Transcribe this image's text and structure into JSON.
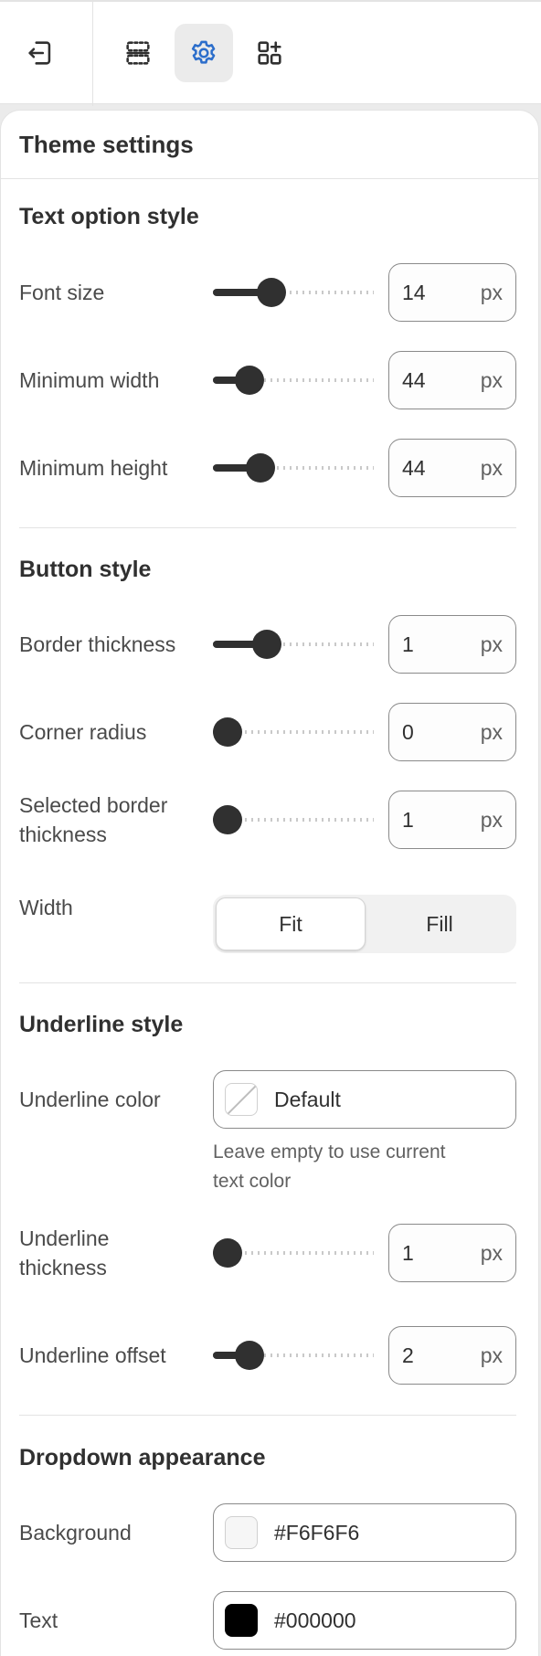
{
  "toolbar": {
    "buttons": [
      {
        "icon": "exit-icon"
      },
      {
        "icon": "sections-icon"
      },
      {
        "icon": "gear-icon",
        "active": true
      },
      {
        "icon": "apps-add-icon"
      }
    ]
  },
  "panel": {
    "title": "Theme settings"
  },
  "text_option_style": {
    "title": "Text option style",
    "font_size": {
      "label": "Font size",
      "value": "14",
      "unit": "px",
      "fraction": 0.33
    },
    "min_width": {
      "label": "Minimum width",
      "value": "44",
      "unit": "px",
      "fraction": 0.17
    },
    "min_height": {
      "label": "Minimum height",
      "value": "44",
      "unit": "px",
      "fraction": 0.25
    }
  },
  "button_style": {
    "title": "Button style",
    "border_thickness": {
      "label": "Border thickness",
      "value": "1",
      "unit": "px",
      "fraction": 0.3
    },
    "corner_radius": {
      "label": "Corner radius",
      "value": "0",
      "unit": "px",
      "fraction": 0.0
    },
    "selected_border": {
      "label_line1": "Selected border",
      "label_line2": "thickness",
      "value": "1",
      "unit": "px",
      "fraction": 0.0
    },
    "width": {
      "label": "Width",
      "options": [
        "Fit",
        "Fill"
      ],
      "selected": "Fit"
    }
  },
  "underline_style": {
    "title": "Underline style",
    "color": {
      "label": "Underline color",
      "value": "Default",
      "help_line1": "Leave empty to use current",
      "help_line2": "text color"
    },
    "thickness": {
      "label_line1": "Underline",
      "label_line2": "thickness",
      "value": "1",
      "unit": "px",
      "fraction": 0.0
    },
    "offset": {
      "label": "Underline offset",
      "value": "2",
      "unit": "px",
      "fraction": 0.17
    }
  },
  "dropdown_appearance": {
    "title": "Dropdown appearance",
    "background": {
      "label": "Background",
      "value": "#F6F6F6",
      "swatch": "#F6F6F6"
    },
    "text": {
      "label": "Text",
      "value": "#000000",
      "swatch": "#000000"
    }
  },
  "colors": {
    "accent": "#2c6ecb",
    "text": "#303030",
    "border": "#8a8a8a"
  }
}
